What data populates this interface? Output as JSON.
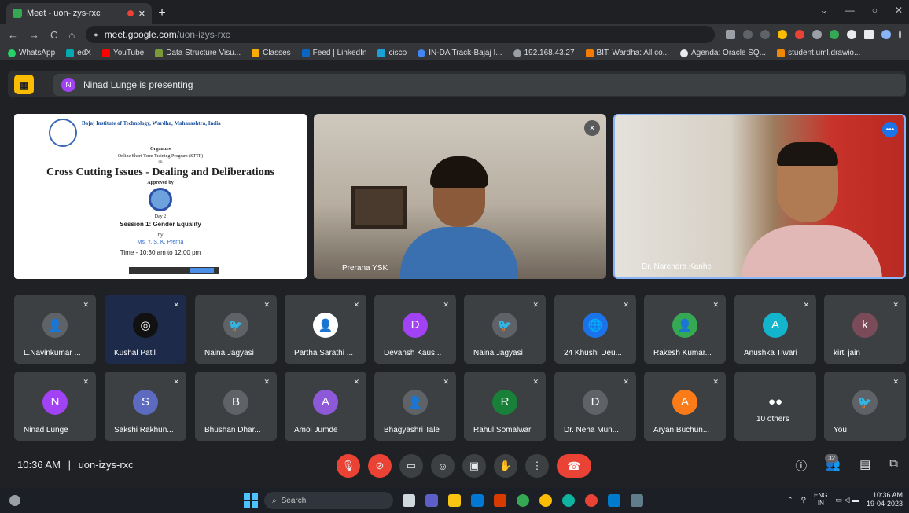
{
  "browser": {
    "tab_title": "Meet - uon-izys-rxc",
    "new_tab": "+",
    "window_controls": [
      "⌄",
      "—",
      "○",
      "✕"
    ],
    "nav": [
      "←",
      "→",
      "C",
      "⌂"
    ],
    "url_host": "meet.google.com",
    "url_path": "/uon-izys-rxc",
    "bookmarks": [
      {
        "label": "WhatsApp",
        "color": "#25d366"
      },
      {
        "label": "edX",
        "color": "#02262b"
      },
      {
        "label": "YouTube",
        "color": "#ff0000"
      },
      {
        "label": "Data Structure Visu...",
        "color": "#7a9a3a"
      },
      {
        "label": "Classes",
        "color": "#f9ab00"
      },
      {
        "label": "Feed | LinkedIn",
        "color": "#0a66c2"
      },
      {
        "label": "cisco",
        "color": "#1ba0d7"
      },
      {
        "label": "IN-DA Track-Bajaj I...",
        "color": "#4285f4"
      },
      {
        "label": "192.168.43.27",
        "color": "#9aa0a6"
      },
      {
        "label": "BIT, Wardha: All co...",
        "color": "#f57c00"
      },
      {
        "label": "Agenda: Oracle SQ...",
        "color": "#e8eaed"
      },
      {
        "label": "student.uml.drawio...",
        "color": "#f08705"
      }
    ]
  },
  "meet": {
    "presenting_text": "Ninad Lunge is presenting",
    "presenter_initial": "N",
    "slide": {
      "institute": "Bajaj Institute of Technology, Wardha, Maharashtra, India",
      "organizes": "Organizes",
      "program": "Online Short Term Training Program (STTP)",
      "on": "on",
      "title": "Cross Cutting Issues - Dealing and Deliberations",
      "approved": "Approved by",
      "day": "Day 2",
      "session": "Session 1: Gender Equality",
      "by": "by",
      "speaker": "Ms. Y. S. K. Prerna",
      "time": "Time - 10:30 am to 12:00 pm"
    },
    "video_tiles": [
      {
        "name": "Prerana YSK"
      },
      {
        "name": "Dr. Narendra Kanhe"
      }
    ],
    "row1": [
      {
        "name": "L.Navinkumar ...",
        "initial": "👤",
        "color": "#5f6368"
      },
      {
        "name": "Kushal Patil",
        "initial": "◎",
        "color": "#111"
      },
      {
        "name": "Naina Jagyasi",
        "initial": "🐦",
        "color": "#5f6368"
      },
      {
        "name": "Partha Sarathi ...",
        "initial": "👤",
        "color": "#ffffff"
      },
      {
        "name": "Devansh Kaus...",
        "initial": "D",
        "color": "#a142f4"
      },
      {
        "name": "Naina Jagyasi",
        "initial": "🐦",
        "color": "#5f6368"
      },
      {
        "name": "24 Khushi Deu...",
        "initial": "🌐",
        "color": "#1a73e8"
      },
      {
        "name": "Rakesh Kumar...",
        "initial": "👤",
        "color": "#34a853"
      },
      {
        "name": "Anushka Tiwari",
        "initial": "A",
        "color": "#12b5cb"
      },
      {
        "name": "kirti jain",
        "initial": "k",
        "color": "#7b4b5a"
      }
    ],
    "row2": [
      {
        "name": "Ninad Lunge",
        "initial": "N",
        "color": "#a142f4"
      },
      {
        "name": "Sakshi Rakhun...",
        "initial": "S",
        "color": "#5c6bc0"
      },
      {
        "name": "Bhushan Dhar...",
        "initial": "B",
        "color": "#5f6368"
      },
      {
        "name": "Amol Jumde",
        "initial": "A",
        "color": "#8e59d8"
      },
      {
        "name": "Bhagyashri Tale",
        "initial": "👤",
        "color": "#5f6368"
      },
      {
        "name": "Rahul Somalwar",
        "initial": "R",
        "color": "#188038"
      },
      {
        "name": "Dr. Neha Mun...",
        "initial": "D",
        "color": "#5f6368"
      },
      {
        "name": "Aryan Buchun...",
        "initial": "A",
        "color": "#fa7b17"
      },
      {
        "name": "10 others",
        "initial": "●●",
        "color": "#3c4043"
      },
      {
        "name": "You",
        "initial": "🐦",
        "color": "#5f6368"
      }
    ],
    "bottom": {
      "time": "10:36 AM",
      "separator": "|",
      "code": "uon-izys-rxc",
      "participants_count": "32"
    }
  },
  "taskbar": {
    "search": "Search",
    "lang1": "ENG",
    "lang2": "IN",
    "time": "10:36 AM",
    "date": "19-04-2023"
  }
}
